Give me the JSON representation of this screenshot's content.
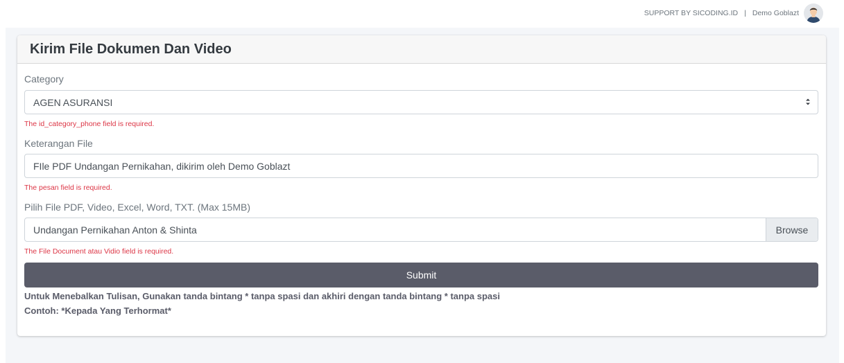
{
  "topbar": {
    "support_text": "SUPPORT BY SICODING.ID",
    "separator": "|",
    "user_name": "Demo Goblazt"
  },
  "card": {
    "title": "Kirim File Dokumen Dan Video"
  },
  "form": {
    "category": {
      "label": "Category",
      "selected": "AGEN ASURANSI",
      "error": "The id_category_phone field is required."
    },
    "keterangan": {
      "label": "Keterangan File",
      "value": "FIle PDF Undangan Pernikahan, dikirim oleh Demo Goblazt",
      "error": "The pesan field is required."
    },
    "file": {
      "label": "Pilih File PDF, Video, Excel, Word, TXT. (Max 15MB)",
      "value": "Undangan Pernikahan Anton & Shinta",
      "browse_label": "Browse",
      "error": "The File Document atau Vidio field is required."
    },
    "submit_label": "Submit",
    "hint_line1": "Untuk Menebalkan Tulisan, Gunakan tanda bintang * tanpa spasi dan akhiri dengan tanda bintang * tanpa spasi",
    "hint_line2": "Contoh: *Kepada Yang Terhormat*"
  },
  "colors": {
    "error": "#dc3545",
    "submit_bg": "#5a5c69",
    "page_bg": "#f4f6f9"
  },
  "icons": {
    "select_caret": "sort-caret-icon",
    "avatar": "user-avatar"
  }
}
